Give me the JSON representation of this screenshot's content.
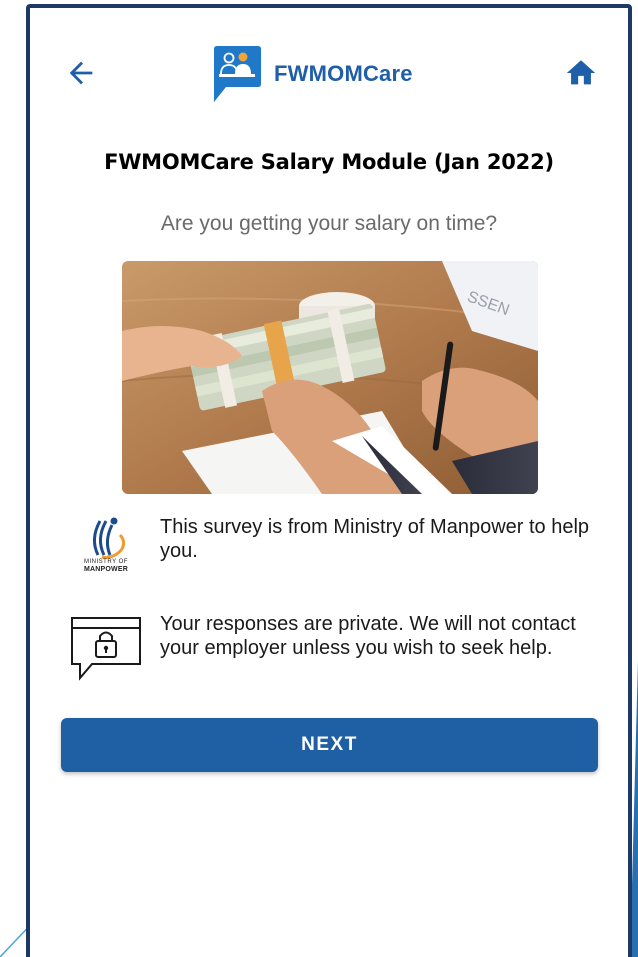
{
  "header": {
    "app_name": "FWMOMCare",
    "back_icon": "arrow-left-icon",
    "home_icon": "home-icon",
    "logo_icon": "chat-people-logo-icon"
  },
  "page": {
    "title": "FWMOMCare Salary Module (Jan 2022)",
    "question": "Are you getting your salary on time?"
  },
  "illustration": {
    "description_icon": "cash-handover-photo"
  },
  "info": [
    {
      "icon": "ministry-of-manpower-logo",
      "logo_line1": "MINISTRY OF",
      "logo_line2": "MANPOWER",
      "text": "This survey is from Ministry of Manpower to help you."
    },
    {
      "icon": "lock-chat-icon",
      "text": "Your responses are private. We will not contact your employer unless you wish to seek help."
    }
  ],
  "actions": {
    "next_label": "NEXT"
  },
  "colors": {
    "brand_blue": "#1f5ea8",
    "button_blue": "#1f5fa3",
    "frame": "#1d3a66",
    "subtitle_gray": "#6a6a6a"
  }
}
